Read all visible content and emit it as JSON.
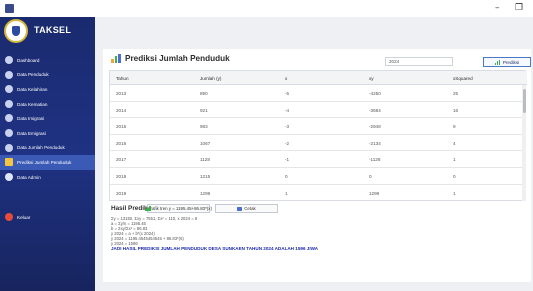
{
  "window": {
    "minimize_glyph": "–",
    "maximize_glyph": "❐"
  },
  "sidebar": {
    "brand": "TAKSEL",
    "items": [
      {
        "label": "Dashboard",
        "icon": "dashboard-icon"
      },
      {
        "label": "Data Penduduk",
        "icon": "people-icon"
      },
      {
        "label": "Data Kelahiran",
        "icon": "baby-icon"
      },
      {
        "label": "Data Kematian",
        "icon": "death-icon"
      },
      {
        "label": "Data Imigrasi",
        "icon": "import-icon"
      },
      {
        "label": "Data Emigrasi",
        "icon": "export-icon"
      },
      {
        "label": "Data Jumlah Penduduk",
        "icon": "population-icon"
      },
      {
        "label": "Prediksi Jumlah Penduduk",
        "icon": "chart-icon"
      },
      {
        "label": "Data Admin",
        "icon": "admin-icon"
      }
    ],
    "logout": "Keluar"
  },
  "main": {
    "title": "Prediksi Jumlah Penduduk",
    "year_input": "2024",
    "predict_button": "Prediksi",
    "table": {
      "headers": [
        "Tahun",
        "Jumlah (y)",
        "x",
        "xy",
        "xSquared"
      ],
      "rows": [
        [
          "2013",
          "890",
          "-5",
          "-4250",
          "25"
        ],
        [
          "2014",
          "921",
          "-4",
          "-3684",
          "16"
        ],
        [
          "2015",
          "983",
          "-3",
          "-2948",
          "9"
        ],
        [
          "2016",
          "1067",
          "-2",
          "-2134",
          "4"
        ],
        [
          "2017",
          "1128",
          "-1",
          "-1128",
          "1"
        ],
        [
          "2018",
          "1215",
          "0",
          "0",
          "0"
        ],
        [
          "2019",
          "1299",
          "1",
          "1299",
          "1"
        ]
      ]
    },
    "result": {
      "title": "Hasil Prediksi",
      "graph_button": "Grafik tren y = 1195.45+86.83*(x)",
      "print_button": "Cetak",
      "lines": [
        "Σy = 13150, Σxy = 7551, Σx² = 110, x 2024 = 6",
        "a = Σy/n = 1195.45",
        "b = Σxy/Σx² = 86.83",
        "y 2024 = a + b*(x 2024)",
        "y 2024 = 1195.4545454545 + 86.83*(6)",
        "y 2024 = 1596"
      ],
      "conclusion": "JADI HASIL PREDIKSI JUMLAH PENDUDUK DESA SUNKAEN TAHUN 2024 ADALAH 1596 JIWA"
    }
  },
  "colors": {
    "sidebar": "#1f3283",
    "active_item": "#3a5ab6",
    "conclusion": "#1a2aa8",
    "icon_green": "#3cb04a",
    "icon_blue": "#4e6fd0"
  }
}
